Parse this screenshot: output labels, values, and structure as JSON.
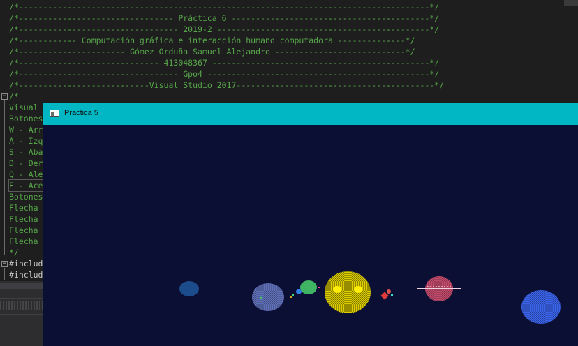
{
  "editor": {
    "header_lines": [
      "/*-------------------------------------------------------------------------------------*/",
      "/*-------------------------------- Práctica 6 -----------------------------------------*/",
      "/*--------------------------------- 2019-2 --------------------------------------------*/",
      "/*------------ Computación gráfica e interacción humano computadora --------------*/",
      "/*---------------------- Gómez Orduña Samuel Alejandro ---------------------------*/",
      "/*----------------------------- 413048367 ---------------------------------------------*/",
      "/*--------------------------------- Gpo4 ----------------------------------------------*/",
      "/*---------------------------Visual Studio 2017-----------------------------------------*/"
    ],
    "body_lines": [
      "/*",
      "Visual",
      "Botones",
      "W - Arr",
      "A - Izq",
      "S - Aba",
      "D - Der",
      "Q - Ale",
      "E - Ace",
      "Botones",
      "Flecha",
      "Flecha",
      "Flecha",
      "Flecha",
      "*/"
    ],
    "code_lines": [
      "#includ",
      "#includ"
    ]
  },
  "window": {
    "title": "Practica 5",
    "titlebar_color": "#00b7c3",
    "viewport_color": "#0b0f33"
  },
  "scene": {
    "objects": [
      {
        "name": "dark-blue-planet",
        "color": "#1d4c8c"
      },
      {
        "name": "slate-blue-planet",
        "color": "#5f70b8"
      },
      {
        "name": "green-planet",
        "color": "#3fb563"
      },
      {
        "name": "small-blue-moon",
        "color": "#2f7fe6"
      },
      {
        "name": "sun",
        "color": "#ffee00"
      },
      {
        "name": "red-moon",
        "color": "#e13a3a"
      },
      {
        "name": "ringed-planet",
        "color": "#c24b6d"
      },
      {
        "name": "blue-planet",
        "color": "#3b63ea"
      }
    ]
  }
}
